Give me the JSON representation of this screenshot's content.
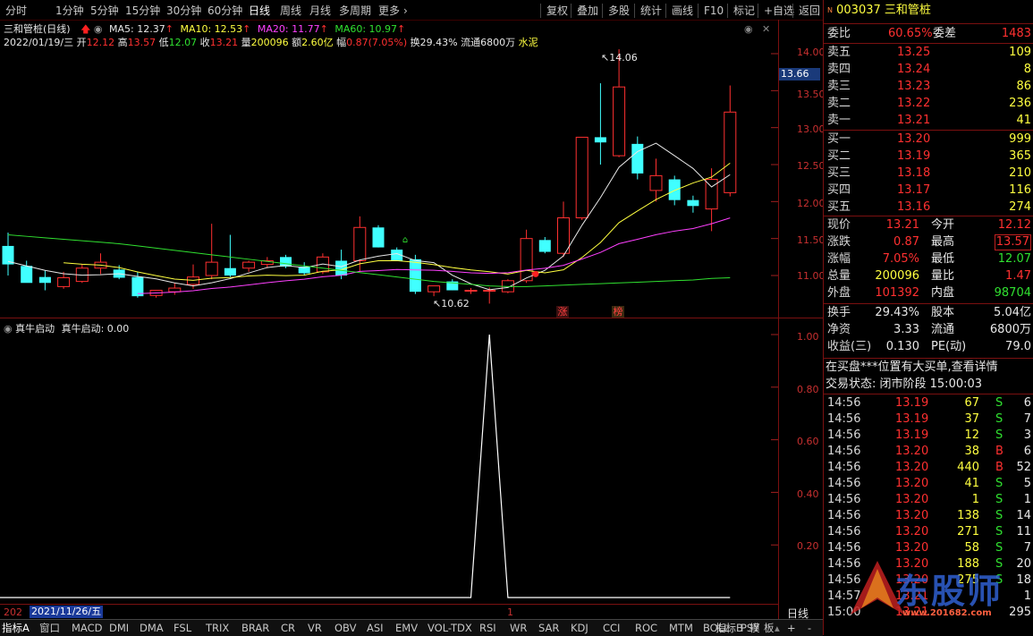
{
  "toolbar": {
    "left": [
      "分时",
      "1分钟",
      "5分钟",
      "15分钟",
      "30分钟",
      "60分钟",
      "日线",
      "周线",
      "月线",
      "多周期",
      "更多"
    ],
    "right": [
      "复权",
      "叠加",
      "多股",
      "统计",
      "画线",
      "F10",
      "标记",
      "+自选",
      "返回"
    ]
  },
  "chart_title": "三和管桩(日线)",
  "ma_legend": [
    {
      "label": "MA5: 12.37",
      "color": "#e8e8e8"
    },
    {
      "label": "MA10: 12.53",
      "color": "#ffff40"
    },
    {
      "label": "MA20: 11.77",
      "color": "#ff40ff"
    },
    {
      "label": "MA60: 10.97",
      "color": "#30e030"
    }
  ],
  "bar_info": {
    "date": "2022/01/19/三",
    "open_label": "开",
    "open": "12.12",
    "high_label": "高",
    "high": "13.57",
    "low_label": "低",
    "low": "12.07",
    "close_label": "收",
    "close": "13.21",
    "vol_label": "量",
    "vol": "200096",
    "amt_label": "额",
    "amt": "2.60亿",
    "chg_label": "幅",
    "chg": "0.87(7.05%)",
    "turn": "换29.43%",
    "float": "流通6800万",
    "industry": "水泥"
  },
  "price_axis": [
    "14.00",
    "13.50",
    "13.00",
    "12.50",
    "12.00",
    "11.50",
    "11.00"
  ],
  "current_price_tag": "13.66",
  "hi_marker": "14.06",
  "lo_marker": "10.62",
  "event_tags": [
    "涨",
    "榜"
  ],
  "indicator": {
    "title": "真牛启动",
    "value_label": "真牛启动: 0.00",
    "axis": [
      "1.00",
      "0.80",
      "0.60",
      "0.40",
      "0.20"
    ]
  },
  "bottom_left": {
    "year_prefix": "202",
    "date": "2021/11/26/五",
    "mark": "1"
  },
  "bottom_right_label": "日线",
  "tabs": [
    "指标A",
    "窗口",
    "MACD",
    "DMI",
    "DMA",
    "FSL",
    "TRIX",
    "BRAR",
    "CR",
    "VR",
    "OBV",
    "ASI",
    "EMV",
    "VOL-TDX",
    "RSI",
    "WR",
    "SAR",
    "KDJ",
    "CCI",
    "ROC",
    "MTM",
    "BOLL",
    "PSY"
  ],
  "tabs_right": [
    "指标B",
    "模",
    "板",
    "+",
    "-"
  ],
  "colors": {
    "up": "#ff3030",
    "down": "#40ffff",
    "ma5": "#e8e8e8",
    "ma10": "#ffff40",
    "ma20": "#ff40ff",
    "ma60": "#30e030"
  },
  "chart_data": {
    "type": "candlestick",
    "ylim": [
      10.5,
      14.2
    ],
    "candles": [
      {
        "o": 11.4,
        "h": 11.58,
        "l": 11.0,
        "c": 11.15
      },
      {
        "o": 11.13,
        "h": 11.2,
        "l": 10.92,
        "c": 10.9
      },
      {
        "o": 10.98,
        "h": 11.07,
        "l": 10.8,
        "c": 10.9
      },
      {
        "o": 10.85,
        "h": 11.05,
        "l": 10.82,
        "c": 10.97
      },
      {
        "o": 10.92,
        "h": 11.15,
        "l": 10.9,
        "c": 11.1
      },
      {
        "o": 11.1,
        "h": 11.3,
        "l": 11.02,
        "c": 11.18
      },
      {
        "o": 11.08,
        "h": 11.14,
        "l": 10.95,
        "c": 10.97
      },
      {
        "o": 10.98,
        "h": 11.05,
        "l": 10.7,
        "c": 10.72
      },
      {
        "o": 10.73,
        "h": 10.8,
        "l": 10.7,
        "c": 10.8
      },
      {
        "o": 10.78,
        "h": 10.9,
        "l": 10.74,
        "c": 10.83
      },
      {
        "o": 10.88,
        "h": 11.15,
        "l": 10.82,
        "c": 10.98
      },
      {
        "o": 11.0,
        "h": 11.7,
        "l": 10.95,
        "c": 11.18
      },
      {
        "o": 11.1,
        "h": 11.55,
        "l": 10.98,
        "c": 11.0
      },
      {
        "o": 11.1,
        "h": 11.2,
        "l": 11.05,
        "c": 11.18
      },
      {
        "o": 11.15,
        "h": 11.25,
        "l": 11.1,
        "c": 11.2
      },
      {
        "o": 11.25,
        "h": 11.28,
        "l": 11.1,
        "c": 11.12
      },
      {
        "o": 11.12,
        "h": 11.18,
        "l": 11.0,
        "c": 11.03
      },
      {
        "o": 11.05,
        "h": 11.3,
        "l": 11.02,
        "c": 11.25
      },
      {
        "o": 11.2,
        "h": 11.35,
        "l": 10.95,
        "c": 11.0
      },
      {
        "o": 11.2,
        "h": 11.8,
        "l": 11.05,
        "c": 11.65
      },
      {
        "o": 11.65,
        "h": 11.68,
        "l": 11.38,
        "c": 11.38
      },
      {
        "o": 11.35,
        "h": 11.38,
        "l": 11.2,
        "c": 11.2
      },
      {
        "o": 11.22,
        "h": 11.28,
        "l": 10.75,
        "c": 10.78
      },
      {
        "o": 10.78,
        "h": 10.86,
        "l": 10.72,
        "c": 10.86
      },
      {
        "o": 10.92,
        "h": 10.95,
        "l": 10.8,
        "c": 10.8
      },
      {
        "o": 10.8,
        "h": 10.83,
        "l": 10.75,
        "c": 10.8
      },
      {
        "o": 10.8,
        "h": 10.84,
        "l": 10.62,
        "c": 10.8
      },
      {
        "o": 10.78,
        "h": 10.95,
        "l": 10.76,
        "c": 10.93
      },
      {
        "o": 10.93,
        "h": 11.62,
        "l": 10.9,
        "c": 11.5
      },
      {
        "o": 11.48,
        "h": 11.52,
        "l": 11.3,
        "c": 11.32
      },
      {
        "o": 11.3,
        "h": 12.0,
        "l": 11.25,
        "c": 11.78
      },
      {
        "o": 11.78,
        "h": 12.87,
        "l": 11.75,
        "c": 12.87
      },
      {
        "o": 12.87,
        "h": 13.6,
        "l": 12.5,
        "c": 12.8
      },
      {
        "o": 12.62,
        "h": 14.06,
        "l": 12.6,
        "c": 13.55
      },
      {
        "o": 12.78,
        "h": 12.88,
        "l": 12.3,
        "c": 12.38
      },
      {
        "o": 12.15,
        "h": 12.58,
        "l": 12.0,
        "c": 12.35
      },
      {
        "o": 12.3,
        "h": 12.35,
        "l": 11.95,
        "c": 12.02
      },
      {
        "o": 12.02,
        "h": 12.08,
        "l": 11.85,
        "c": 11.94
      },
      {
        "o": 11.9,
        "h": 12.45,
        "l": 11.6,
        "c": 12.3
      },
      {
        "o": 12.12,
        "h": 13.57,
        "l": 12.07,
        "c": 13.21
      }
    ],
    "indicator_values": [
      0,
      0,
      0,
      0,
      0,
      0,
      0,
      0,
      0,
      0,
      0,
      0,
      0,
      0,
      0,
      0,
      0,
      0,
      0,
      0,
      0,
      0,
      0,
      0,
      0,
      0,
      1,
      0,
      0,
      0,
      0,
      0,
      0,
      0,
      0,
      0,
      0,
      0,
      0,
      0
    ]
  },
  "quote": {
    "code": "003037",
    "name": "三和管桩",
    "weibi_label": "委比",
    "weibi": "60.65%",
    "weicha_label": "委差",
    "weicha": "1483",
    "asks": [
      {
        "label": "卖五",
        "price": "13.25",
        "vol": "109"
      },
      {
        "label": "卖四",
        "price": "13.24",
        "vol": "8"
      },
      {
        "label": "卖三",
        "price": "13.23",
        "vol": "86"
      },
      {
        "label": "卖二",
        "price": "13.22",
        "vol": "236"
      },
      {
        "label": "卖一",
        "price": "13.21",
        "vol": "41"
      }
    ],
    "bids": [
      {
        "label": "买一",
        "price": "13.20",
        "vol": "999"
      },
      {
        "label": "买二",
        "price": "13.19",
        "vol": "365"
      },
      {
        "label": "买三",
        "price": "13.18",
        "vol": "210"
      },
      {
        "label": "买四",
        "price": "13.17",
        "vol": "116"
      },
      {
        "label": "买五",
        "price": "13.16",
        "vol": "274"
      }
    ],
    "stats": [
      {
        "l1": "现价",
        "v1": "13.21",
        "c1": "red",
        "l2": "今开",
        "v2": "12.12",
        "c2": "red"
      },
      {
        "l1": "涨跌",
        "v1": "0.87",
        "c1": "red",
        "l2": "最高",
        "v2": "13.57",
        "c2": "red"
      },
      {
        "l1": "涨幅",
        "v1": "7.05%",
        "c1": "red",
        "l2": "最低",
        "v2": "12.07",
        "c2": "grn"
      },
      {
        "l1": "总量",
        "v1": "200096",
        "c1": "yel",
        "l2": "量比",
        "v2": "1.47",
        "c2": "red"
      },
      {
        "l1": "外盘",
        "v1": "101392",
        "c1": "red",
        "l2": "内盘",
        "v2": "98704",
        "c2": "grn"
      }
    ],
    "stats2": [
      {
        "l1": "换手",
        "v1": "29.43%",
        "l2": "股本",
        "v2": "5.04亿"
      },
      {
        "l1": "净资",
        "v1": "3.33",
        "l2": "流通",
        "v2": "6800万"
      },
      {
        "l1": "收益(三)",
        "v1": "0.130",
        "l2": "PE(动)",
        "v2": "79.0"
      }
    ],
    "notice": "在买盘***位置有大买单,查看详情",
    "status": "交易状态: 闭市阶段 15:00:03",
    "ticks": [
      {
        "t": "14:56",
        "p": "13.19",
        "v": "67",
        "d": "S",
        "n": "6"
      },
      {
        "t": "14:56",
        "p": "13.19",
        "v": "37",
        "d": "S",
        "n": "7"
      },
      {
        "t": "14:56",
        "p": "13.19",
        "v": "12",
        "d": "S",
        "n": "3"
      },
      {
        "t": "14:56",
        "p": "13.20",
        "v": "38",
        "d": "B",
        "n": "6"
      },
      {
        "t": "14:56",
        "p": "13.20",
        "v": "440",
        "d": "B",
        "n": "52"
      },
      {
        "t": "14:56",
        "p": "13.20",
        "v": "41",
        "d": "S",
        "n": "5"
      },
      {
        "t": "14:56",
        "p": "13.20",
        "v": "1",
        "d": "S",
        "n": "1"
      },
      {
        "t": "14:56",
        "p": "13.20",
        "v": "138",
        "d": "S",
        "n": "14"
      },
      {
        "t": "14:56",
        "p": "13.20",
        "v": "271",
        "d": "S",
        "n": "11"
      },
      {
        "t": "14:56",
        "p": "13.20",
        "v": "58",
        "d": "S",
        "n": "7"
      },
      {
        "t": "14:56",
        "p": "13.20",
        "v": "188",
        "d": "S",
        "n": "20"
      },
      {
        "t": "14:56",
        "p": "13.20",
        "v": "275",
        "d": "S",
        "n": "18"
      },
      {
        "t": "14:57",
        "p": "13.21",
        "v": "",
        "d": "",
        "n": "1"
      },
      {
        "t": "15:00",
        "p": "13.21",
        "v": "",
        "d": "",
        "n": "295"
      }
    ]
  },
  "watermark": {
    "text": "东股师",
    "url": "www.201682.com"
  }
}
